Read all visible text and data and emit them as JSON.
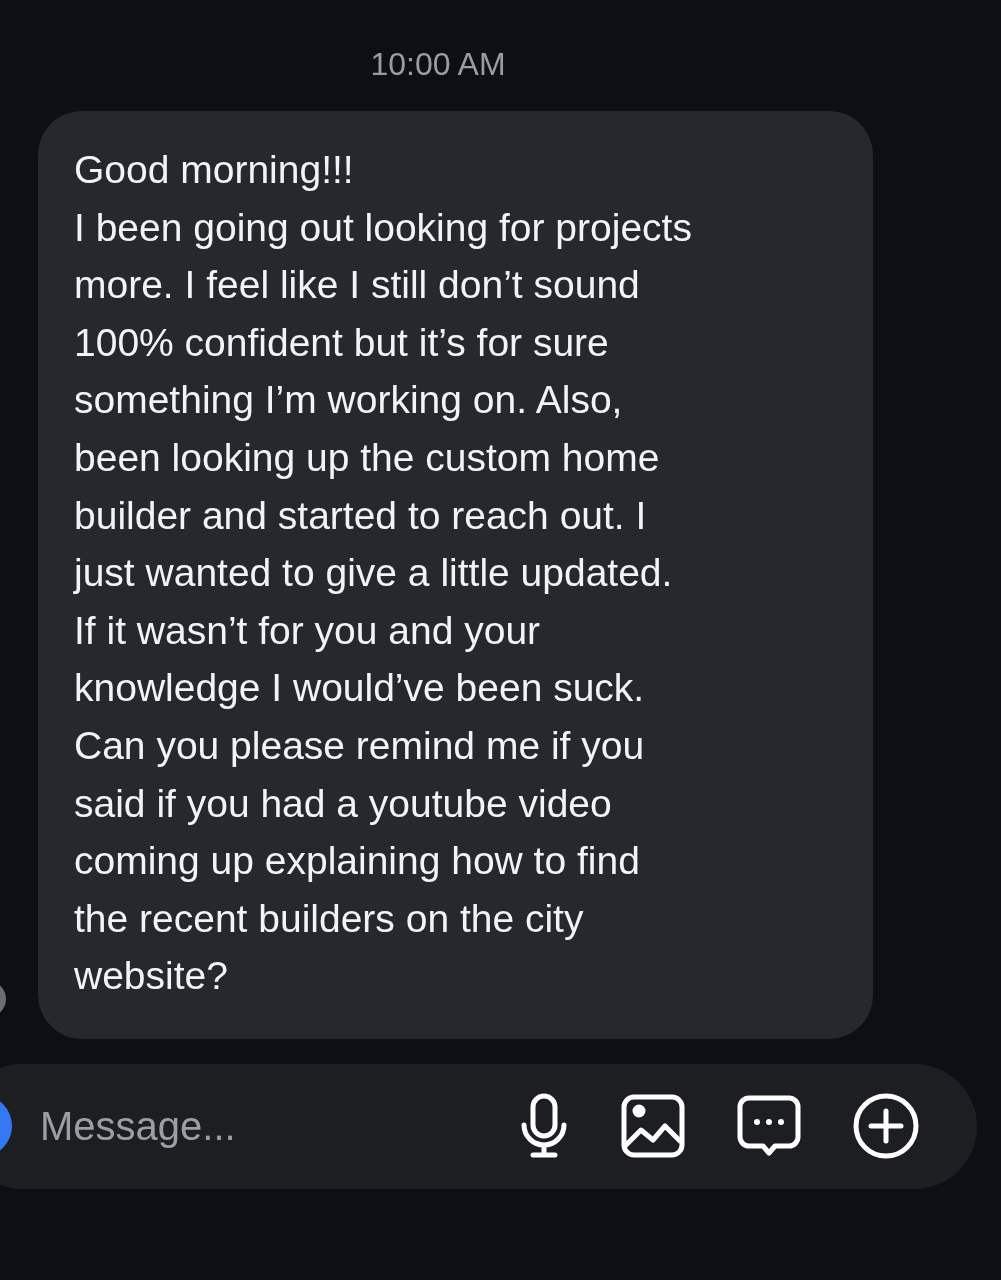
{
  "timestamp": "10:00 AM",
  "message": {
    "text": "Good morning!!!\nI been going out looking for projects\nmore. I feel like I still don’t sound\n100% confident but it’s for sure\nsomething I’m working on. Also,\nbeen looking up the custom home\nbuilder and started to reach out. I\njust wanted to give a little updated.\nIf it wasn’t for you and your\nknowledge I would’ve been suck.\nCan you please remind me if you\nsaid if you had a youtube video\ncoming up explaining how to find\nthe recent builders on the city\nwebsite?"
  },
  "composer": {
    "placeholder": "Message..."
  }
}
